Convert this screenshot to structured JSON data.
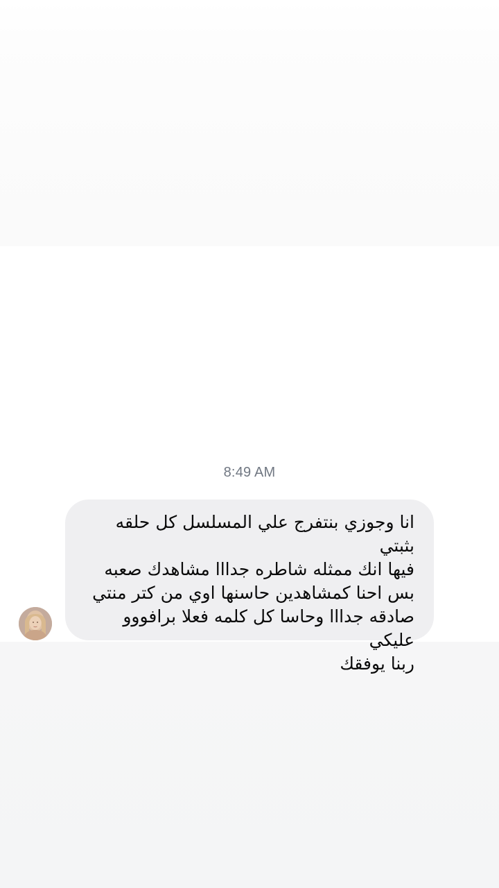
{
  "chat": {
    "timestamp": "8:49 AM",
    "message": {
      "text": "انا وجوزي بنتفرج علي المسلسل كل حلقه بثبتي\nفيها انك ممثله شاطره جدااا مشاهدك صعبه\nبس احنا كمشاهدين حاسنها اوي من كتر منتي\nصادقه جدااا وحاسا كل كلمه فعلا برافووو عليكي\nربنا يوفقك",
      "bubble_color": "#efeff1",
      "text_color": "#0a0a0a"
    },
    "sender": {
      "avatar_icon": "profile-photo"
    },
    "colors": {
      "timestamp": "#707782",
      "background": "#ffffff",
      "lower_panel": "#f5f5f6"
    }
  }
}
